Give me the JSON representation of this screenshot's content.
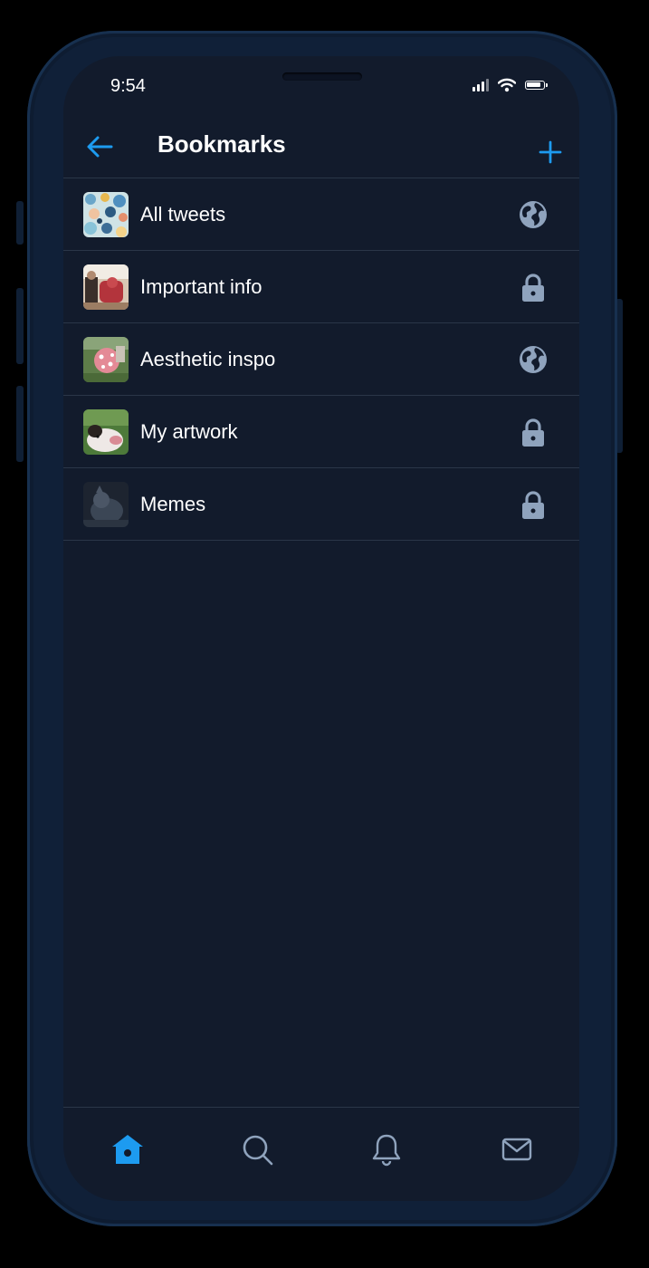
{
  "status_bar": {
    "time": "9:54"
  },
  "header": {
    "title": "Bookmarks",
    "back_icon": "arrow-left-icon",
    "add_icon": "plus-icon"
  },
  "bookmarks": [
    {
      "label": "All tweets",
      "visibility": "public",
      "icon": "globe-icon"
    },
    {
      "label": "Important info",
      "visibility": "private",
      "icon": "lock-icon"
    },
    {
      "label": "Aesthetic inspo",
      "visibility": "public",
      "icon": "globe-icon"
    },
    {
      "label": "My artwork",
      "visibility": "private",
      "icon": "lock-icon"
    },
    {
      "label": "Memes",
      "visibility": "private",
      "icon": "lock-icon"
    }
  ],
  "tabbar": {
    "tabs": [
      {
        "name": "home",
        "icon": "home-icon",
        "active": true
      },
      {
        "name": "search",
        "icon": "search-icon",
        "active": false
      },
      {
        "name": "notifications",
        "icon": "bell-icon",
        "active": false
      },
      {
        "name": "messages",
        "icon": "mail-icon",
        "active": false
      }
    ]
  },
  "colors": {
    "accent": "#1d9bf0",
    "background": "#121b2c",
    "icon_muted": "#8fa3bd",
    "divider": "#2a3648",
    "text": "#ffffff"
  }
}
